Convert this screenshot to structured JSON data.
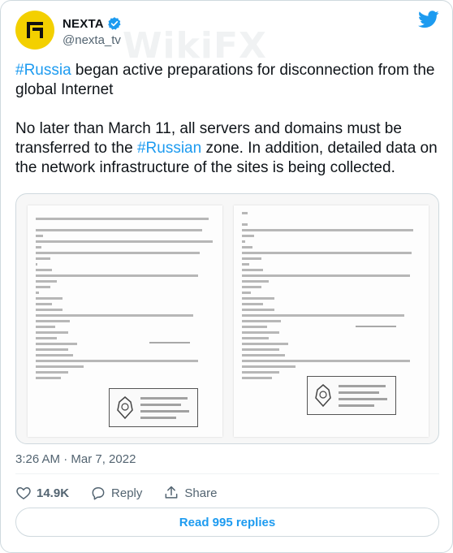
{
  "user": {
    "display_name": "NEXTA",
    "handle": "@nexta_tv",
    "verified": true,
    "avatar_icon": "nexta-logo-icon"
  },
  "tweet": {
    "hashtag_1": "#Russia",
    "text_1": " began active preparations for disconnection from the global Internet",
    "text_2a": "No later than March 11, all servers and domains must be transferred to the ",
    "hashtag_2": "#Russian",
    "text_2b": " zone. In addition, detailed data on the network infrastructure of the sites is being collected."
  },
  "meta": {
    "timestamp": "3:26 AM · Mar 7, 2022"
  },
  "actions": {
    "likes_count": "14.9K",
    "reply_label": "Reply",
    "share_label": "Share"
  },
  "read_replies_label": "Read 995 replies",
  "watermark_text": "WikiFX",
  "colors": {
    "link": "#1d9bf0",
    "secondary_text": "#536471",
    "border": "#cfd9de",
    "twitter_blue": "#1d9bf0",
    "like_red": "#f91880"
  }
}
